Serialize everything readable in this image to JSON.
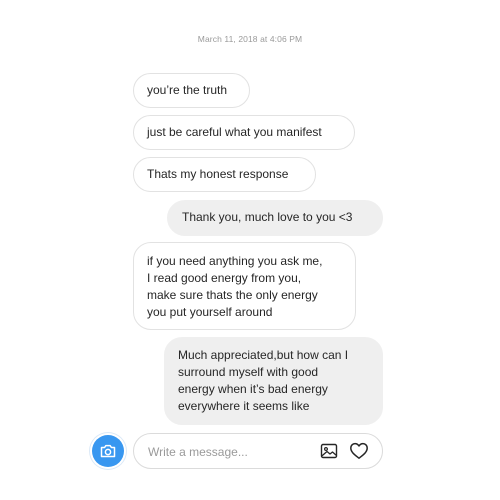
{
  "thread": {
    "timestamp": "March 11, 2018 at 4:06 PM",
    "messages": [
      {
        "from": "other",
        "text": "you’re the truth"
      },
      {
        "from": "other",
        "text": "just be careful what you manifest"
      },
      {
        "from": "other",
        "text": "Thats my honest response"
      },
      {
        "from": "me",
        "text": "Thank you, much love to you <3"
      },
      {
        "from": "other",
        "text": "if you need anything you ask me,\nI read good energy from you,\nmake sure thats the only energy\nyou put yourself around"
      },
      {
        "from": "me",
        "text": "Much appreciated,but how can I\nsurround myself with good\nenergy when it’s bad energy\neverywhere it seems like"
      }
    ]
  },
  "composer": {
    "placeholder": "Write a message...",
    "camera_icon": "camera-icon",
    "gallery_icon": "image-icon",
    "like_icon": "heart-icon",
    "accent_color": "#3897f0"
  }
}
